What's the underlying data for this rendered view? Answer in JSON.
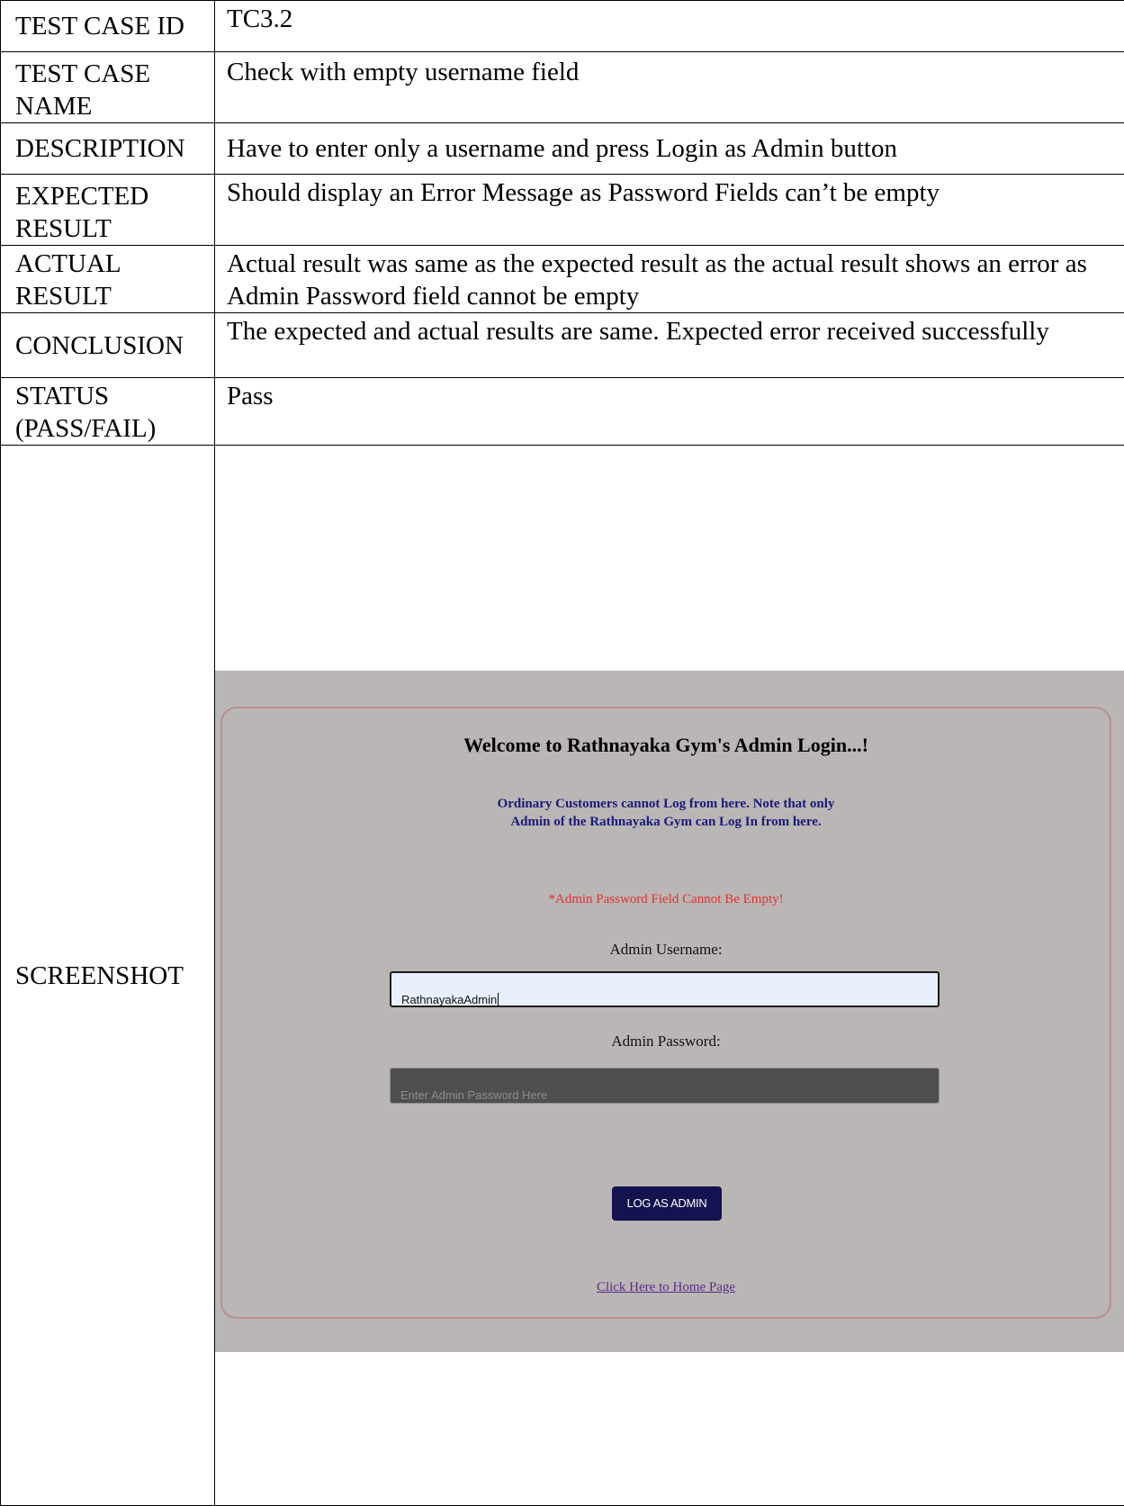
{
  "rows": [
    {
      "key": "TEST CASE ID",
      "value": "TC3.2"
    },
    {
      "key": "TEST CASE NAME",
      "value": "Check with empty username field"
    },
    {
      "key": "DESCRIPTION",
      "value": "Have to enter only a username and press Login as Admin button"
    },
    {
      "key": "EXPECTED RESULT",
      "value": "Should display an Error Message as Password Fields can’t be empty"
    },
    {
      "key": "ACTUAL RESULT",
      "value": "Actual result was same as the expected result as the actual result shows an error as Admin Password field cannot be empty"
    },
    {
      "key": "CONCLUSION",
      "value": "The expected and actual results are same. Expected error received successfully"
    },
    {
      "key": "STATUS (PASS/FAIL)",
      "value": "Pass"
    }
  ],
  "screenshot_label": "SCREENSHOT",
  "login": {
    "welcome": "Welcome to Rathnayaka Gym's Admin Login...!",
    "note_line1": "Ordinary Customers cannot Log from here. Note that only",
    "note_line2": "Admin of the Rathnayaka Gym can Log In from here.",
    "error": "*Admin Password Field Cannot Be Empty!",
    "username_label": "Admin Username:",
    "username_value": "RathnayakaAdmin",
    "password_label": "Admin Password:",
    "password_placeholder": "Enter Admin Password Here",
    "button": "LOG AS ADMIN",
    "home_link": "Click Here to Home Page"
  }
}
